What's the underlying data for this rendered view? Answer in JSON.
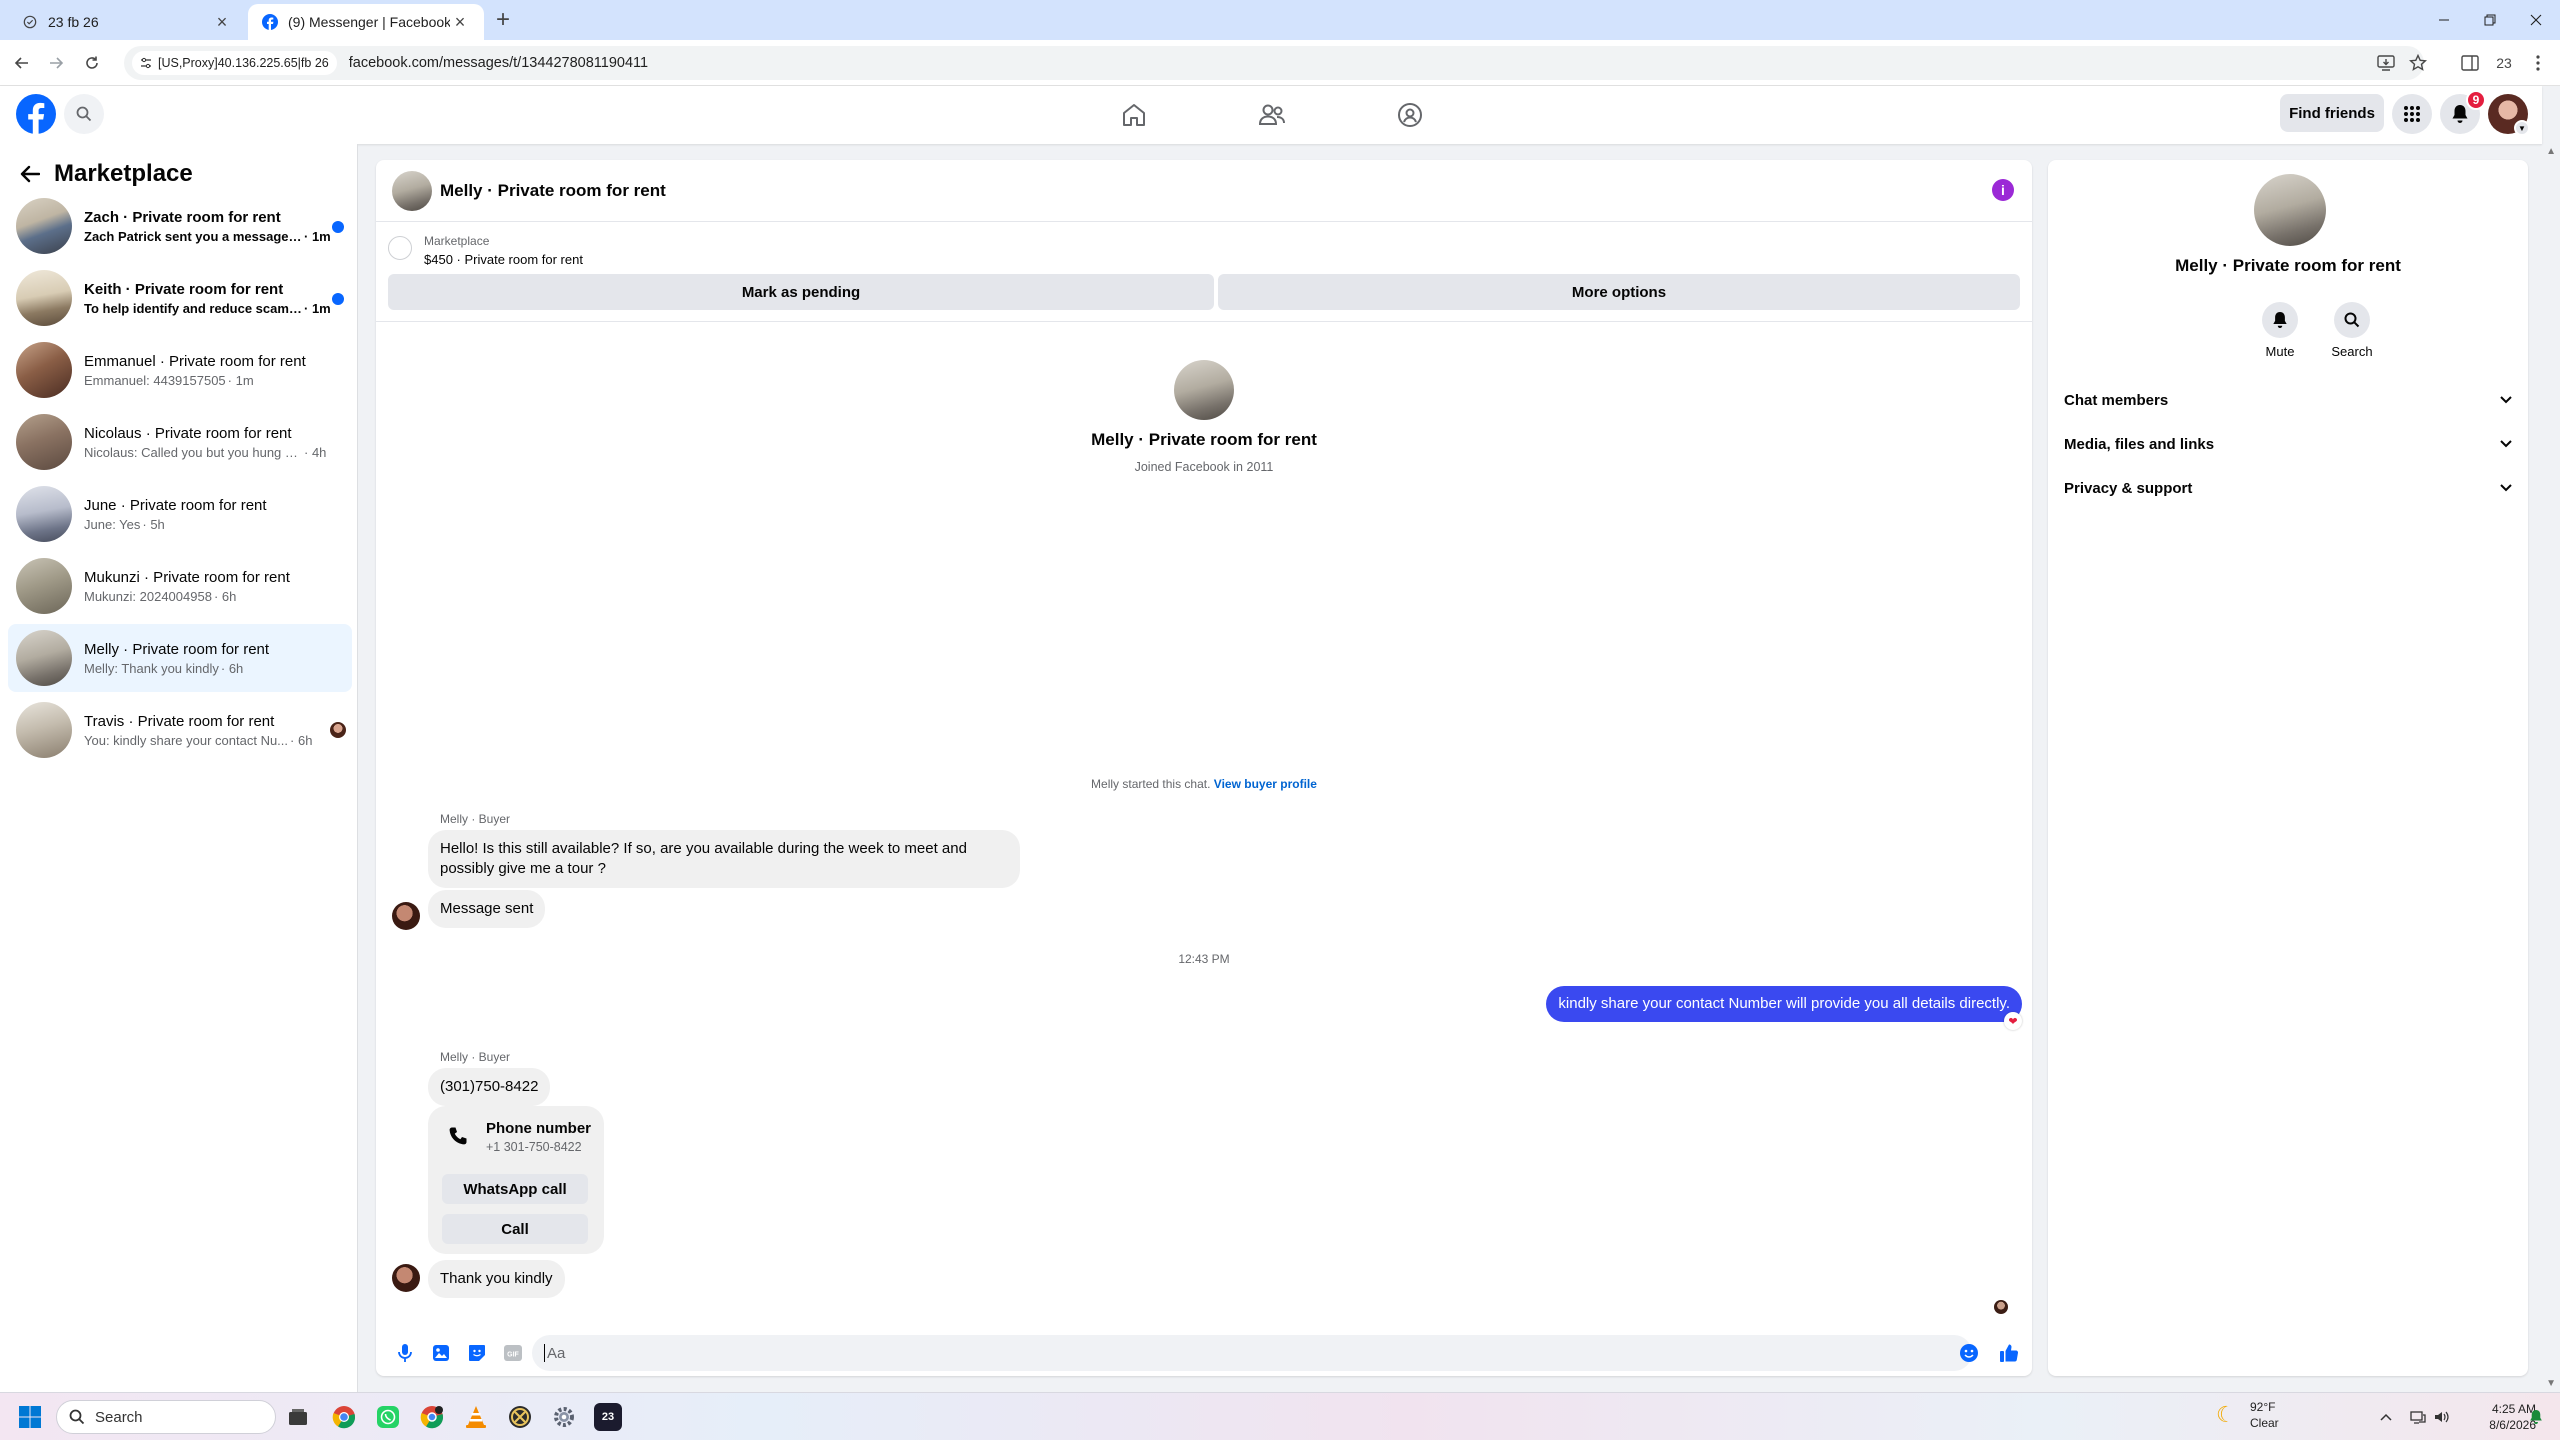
{
  "browser": {
    "tabs": [
      {
        "label": "23 fb 26",
        "active": false
      },
      {
        "label": "(9) Messenger | Facebook",
        "active": true
      }
    ],
    "proxy_chip": "[US,Proxy]40.136.225.65|fb 26",
    "url": "facebook.com/messages/t/1344278081190411",
    "profile_label": "23"
  },
  "fb": {
    "find_friends": "Find friends",
    "notification_count": "9",
    "brand_color": "#0866ff"
  },
  "sidebar": {
    "title": "Marketplace",
    "conversations": [
      {
        "name": "Zach · Private room for rent",
        "preview": "Zach Patrick sent you a message a...",
        "time": "· 1m",
        "unread": true
      },
      {
        "name": "Keith · Private room for rent",
        "preview": "To help identify and reduce scams...",
        "time": "· 1m",
        "unread": true
      },
      {
        "name": "Emmanuel · Private room for rent",
        "preview": "Emmanuel: 4439157505",
        "time": "· 1m",
        "unread": false
      },
      {
        "name": "Nicolaus · Private room for rent",
        "preview": "Nicolaus: Called you but you hung up...",
        "time": "· 4h",
        "unread": false
      },
      {
        "name": "June · Private room for rent",
        "preview": "June: Yes",
        "time": "· 5h",
        "unread": false
      },
      {
        "name": "Mukunzi · Private room for rent",
        "preview": "Mukunzi: 2024004958",
        "time": "· 6h",
        "unread": false
      },
      {
        "name": "Melly · Private room for rent",
        "preview": "Melly: Thank you kindly",
        "time": "· 6h",
        "unread": false,
        "selected": true
      },
      {
        "name": "Travis · Private room for rent",
        "preview": "You: kindly share your contact Nu...",
        "time": "· 6h",
        "unread": false,
        "seen": true
      }
    ]
  },
  "chat": {
    "header_name": "Melly · Private room for rent",
    "marketplace_label": "Marketplace",
    "listing": "$450 · Private room for rent",
    "mark_pending": "Mark as pending",
    "more_options": "More options",
    "intro_name": "Melly · Private room for rent",
    "intro_sub": "Joined Facebook in 2011",
    "started_text": "Melly started this chat.",
    "view_buyer_profile": "View buyer profile",
    "sender_label": "Melly · Buyer",
    "msg1_line1": "Hello! Is this still available? If so, are you available during the week to meet and",
    "msg1_line2": "possibly give me a tour ?",
    "msg2": "Message sent",
    "timestamp": "12:43 PM",
    "outgoing": "kindly share your contact Number will provide you all details directly.",
    "sender_label2": "Melly · Buyer",
    "msg3": "(301)750-8422",
    "phone_card_title": "Phone number",
    "phone_card_number": "+1 301-750-8422",
    "whatsapp_call": "WhatsApp call",
    "call": "Call",
    "msg4": "Thank you kindly",
    "composer_placeholder": "Aa",
    "outgoing_color": "#3a49f0"
  },
  "info": {
    "name": "Melly · Private room for rent",
    "mute": "Mute",
    "search": "Search",
    "rows": [
      "Chat members",
      "Media, files and links",
      "Privacy & support"
    ]
  },
  "taskbar": {
    "search": "Search",
    "weather_temp": "92°F",
    "weather_desc": "Clear",
    "time": "4:25 AM",
    "date": "8/6/2026",
    "app_badge": "23"
  }
}
